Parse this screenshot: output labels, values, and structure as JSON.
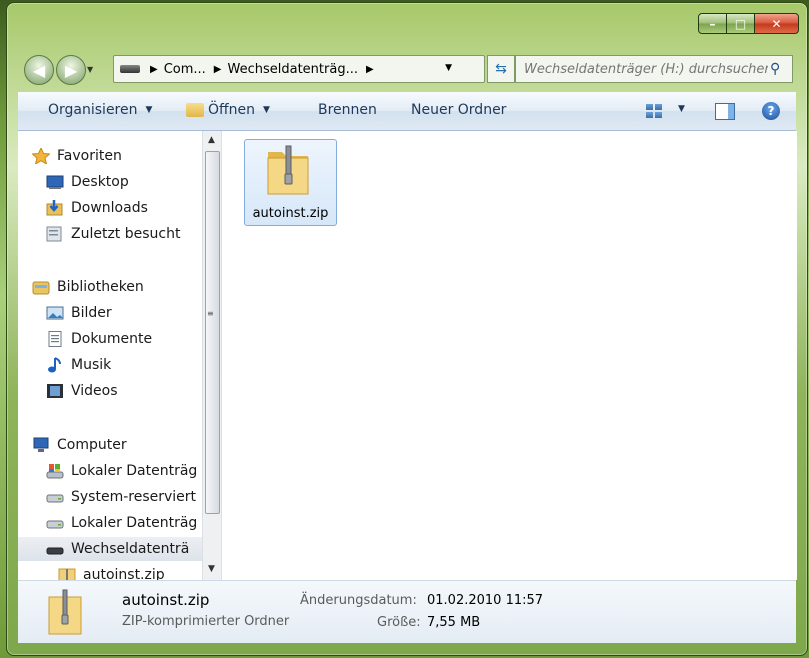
{
  "window": {
    "caption": {
      "minimize": "–",
      "maximize": "□",
      "close": "✕"
    }
  },
  "address_bar": {
    "segments": [
      "Com...",
      "Wechseldatenträg..."
    ],
    "search_placeholder": "Wechseldatenträger (H:) durchsuchen"
  },
  "toolbar": {
    "organize": "Organisieren",
    "open": "Öffnen",
    "burn": "Brennen",
    "new_folder": "Neuer Ordner"
  },
  "nav_pane": {
    "favorites": {
      "label": "Favoriten",
      "items": [
        "Desktop",
        "Downloads",
        "Zuletzt besucht"
      ]
    },
    "libraries": {
      "label": "Bibliotheken",
      "items": [
        "Bilder",
        "Dokumente",
        "Musik",
        "Videos"
      ]
    },
    "computer": {
      "label": "Computer",
      "items": [
        "Lokaler Datenträg",
        "System-reserviert",
        "Lokaler Datenträg",
        "Wechseldatenträ",
        "autoinst.zip"
      ]
    }
  },
  "files": [
    {
      "name": "autoinst.zip",
      "icon": "zip-folder-icon"
    }
  ],
  "details": {
    "name": "autoinst.zip",
    "type": "ZIP-komprimierter Ordner",
    "modified_label": "Änderungsdatum:",
    "modified_value": "01.02.2010 11:57",
    "size_label": "Größe:",
    "size_value": "7,55 MB"
  },
  "colors": {
    "accent": "#1e395b",
    "selection": "#d6e7f9"
  }
}
